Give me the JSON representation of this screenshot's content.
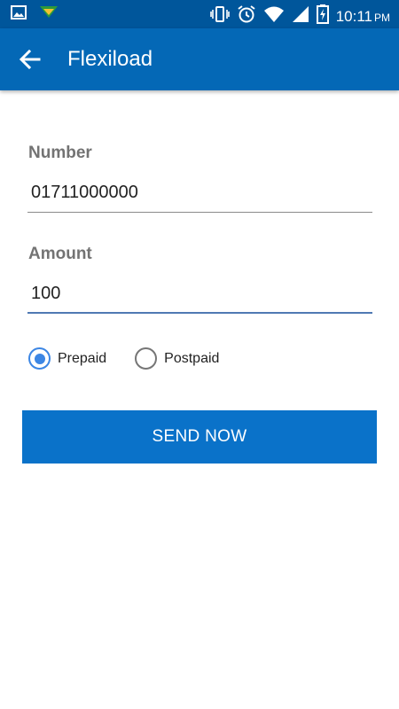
{
  "status_bar": {
    "time": "10:11",
    "ampm": "PM",
    "icons": [
      "gallery-icon",
      "app-notification-icon",
      "vibrate-icon",
      "alarm-icon",
      "wifi-icon",
      "signal-icon",
      "battery-charging-icon"
    ]
  },
  "app_bar": {
    "title": "Flexiload",
    "back_icon": "arrow-back-icon"
  },
  "form": {
    "number_label": "Number",
    "number_value": "01711000000",
    "amount_label": "Amount",
    "amount_value": "100",
    "plan_options": [
      {
        "label": "Prepaid",
        "checked": true
      },
      {
        "label": "Postpaid",
        "checked": false
      }
    ],
    "submit_label": "SEND NOW"
  },
  "colors": {
    "status_bar": "#00569b",
    "app_bar": "#0468b6",
    "button": "#0a72c9",
    "radio_accent": "#3c86e4"
  }
}
